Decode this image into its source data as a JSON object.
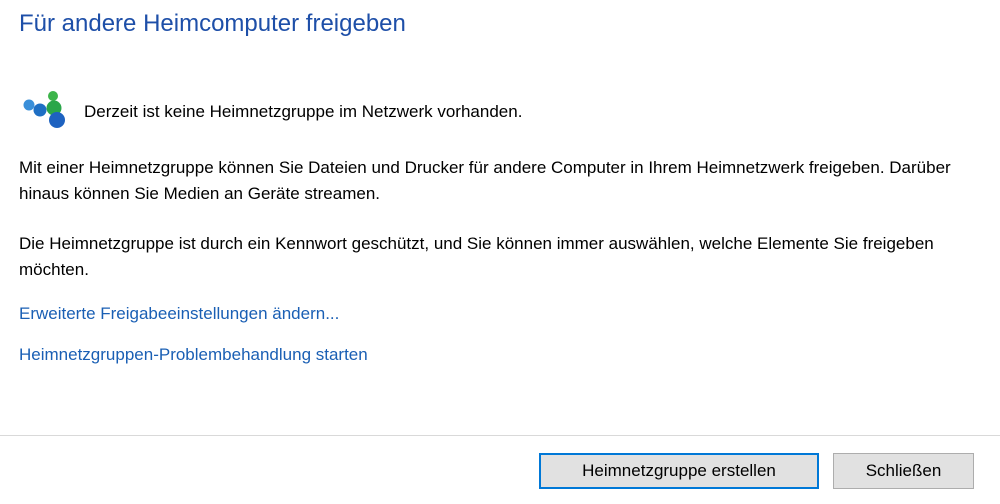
{
  "dialog": {
    "title": "Für andere Heimcomputer freigeben",
    "status": {
      "icon": "homegroup-icon",
      "text": "Derzeit ist keine Heimnetzgruppe im Netzwerk vorhanden."
    },
    "paragraphs": [
      "Mit einer Heimnetzgruppe können Sie Dateien und Drucker für andere Computer in Ihrem Heimnetzwerk freigeben. Darüber hinaus können Sie Medien an Geräte streamen.",
      "Die Heimnetzgruppe ist durch ein Kennwort geschützt, und Sie können immer auswählen, welche Elemente Sie freigeben möchten."
    ],
    "links": [
      "Erweiterte Freigabeeinstellungen ändern...",
      "Heimnetzgruppen-Problembehandlung starten"
    ],
    "buttons": {
      "create": "Heimnetzgruppe erstellen",
      "close": "Schließen"
    }
  },
  "colors": {
    "title": "#1e4fa8",
    "link": "#1a5fb4",
    "primary_border": "#0078d7",
    "button_bg": "#e1e1e1",
    "icon_blue": "#1f8fd8",
    "icon_green": "#3cb44a"
  }
}
